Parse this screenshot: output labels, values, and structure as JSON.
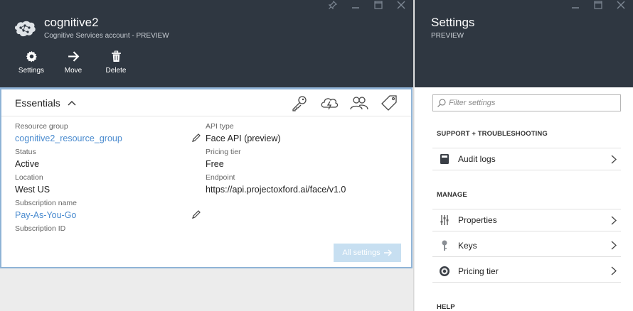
{
  "resource_blade": {
    "title": "cognitive2",
    "subtitle": "Cognitive Services account - PREVIEW",
    "commands": [
      {
        "label": "Settings",
        "icon": "gear-icon"
      },
      {
        "label": "Move",
        "icon": "arrow-right-icon"
      },
      {
        "label": "Delete",
        "icon": "trash-icon"
      }
    ],
    "essentials": {
      "label": "Essentials",
      "left": [
        {
          "key": "Resource group",
          "value": "cognitive2_resource_group"
        },
        {
          "key": "Status",
          "value": "Active"
        },
        {
          "key": "Location",
          "value": "West US"
        },
        {
          "key": "Subscription name",
          "value": "Pay-As-You-Go"
        },
        {
          "key": "Subscription ID",
          "value": ""
        }
      ],
      "right": [
        {
          "key": "API type",
          "value": "Face API (preview)"
        },
        {
          "key": "Pricing tier",
          "value": "Free"
        },
        {
          "key": "Endpoint",
          "value": "https://api.projectoxford.ai/face/v1.0"
        }
      ],
      "all_settings_label": "All settings"
    }
  },
  "settings_blade": {
    "title": "Settings",
    "subtitle": "PREVIEW",
    "filter_placeholder": "Filter settings",
    "sections": [
      {
        "header": "SUPPORT + TROUBLESHOOTING",
        "items": [
          {
            "label": "Audit logs",
            "icon": "audit-log-icon"
          }
        ]
      },
      {
        "header": "MANAGE",
        "items": [
          {
            "label": "Properties",
            "icon": "properties-icon"
          },
          {
            "label": "Keys",
            "icon": "key-icon"
          },
          {
            "label": "Pricing tier",
            "icon": "pricing-tier-icon"
          }
        ]
      },
      {
        "header": "HELP",
        "items": []
      }
    ]
  },
  "colors": {
    "header_bg": "#2f3741",
    "link": "#4a8bcf",
    "accent_border": "#8fb3d6",
    "all_settings_bg": "#c7dff1"
  }
}
